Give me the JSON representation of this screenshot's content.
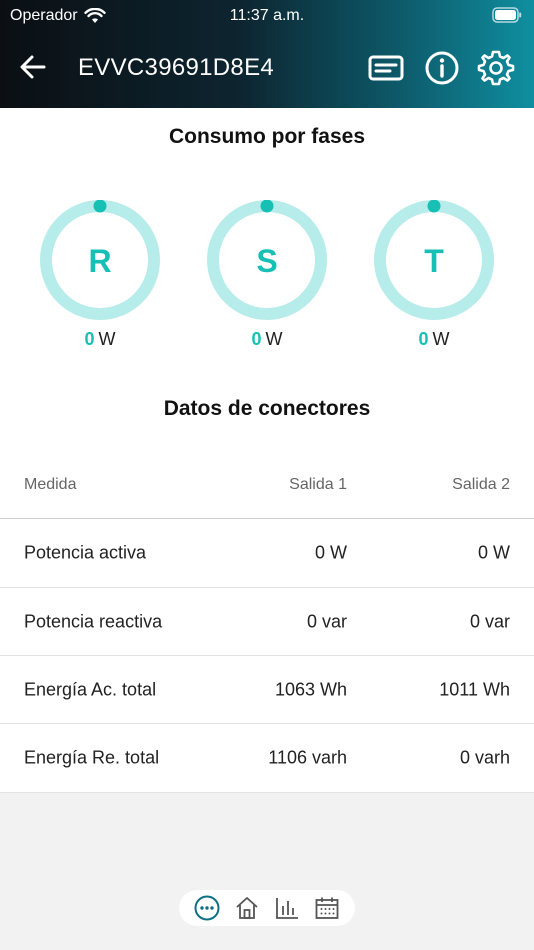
{
  "status_bar": {
    "carrier": "Operador",
    "time": "11:37 a.m."
  },
  "header": {
    "title": "EVVC39691D8E4"
  },
  "phases": {
    "title": "Consumo por fases",
    "items": [
      {
        "label": "R",
        "value": "0",
        "unit": "W"
      },
      {
        "label": "S",
        "value": "0",
        "unit": "W"
      },
      {
        "label": "T",
        "value": "0",
        "unit": "W"
      }
    ]
  },
  "connectors": {
    "title": "Datos de conectores",
    "headers": [
      "Medida",
      "Salida 1",
      "Salida 2"
    ],
    "rows": [
      [
        "Potencia activa",
        "0 W",
        "0 W"
      ],
      [
        "Potencia reactiva",
        "0 var",
        "0 var"
      ],
      [
        "Energía Ac. total",
        "1063 Wh",
        "1011 Wh"
      ],
      [
        "Energía Re. total",
        "1106 varh",
        "0 varh"
      ]
    ]
  },
  "colors": {
    "accent": "#17bfb5",
    "ring": "#b6ecea",
    "nav_active": "#0f6f86"
  },
  "nav": {
    "items": [
      "more-icon",
      "home-icon",
      "chart-icon",
      "calendar-icon"
    ]
  }
}
